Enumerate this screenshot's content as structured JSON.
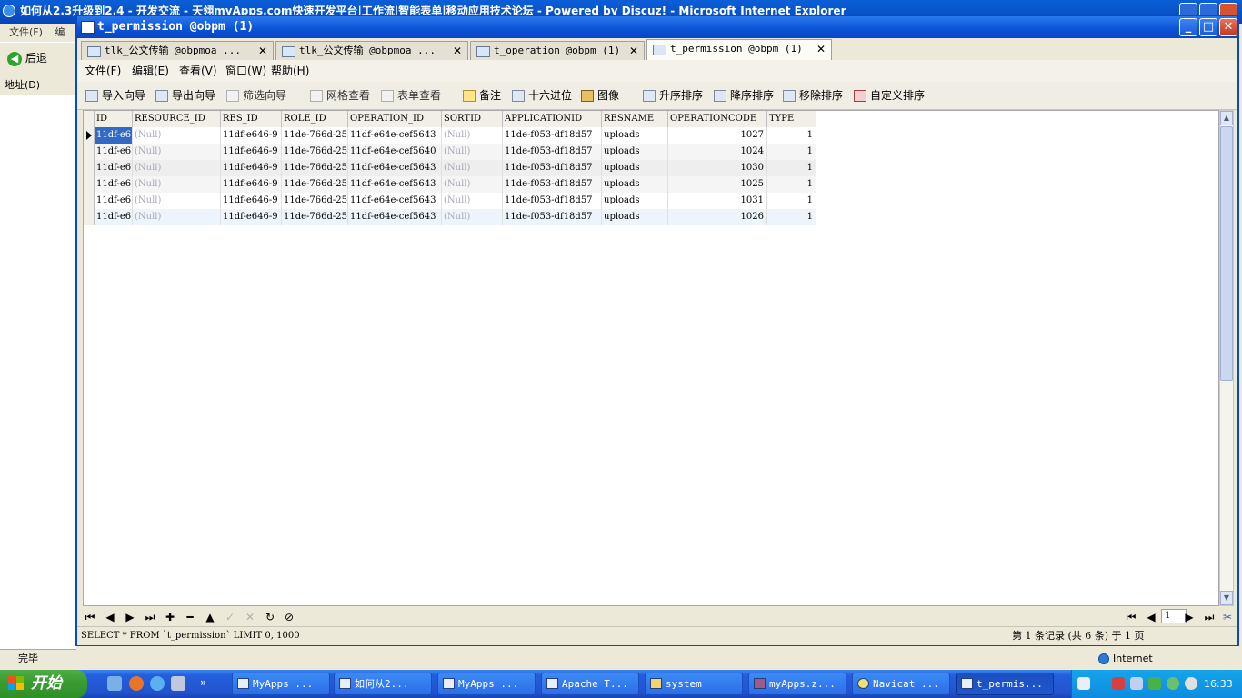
{
  "bg_ie": {
    "title": "如何从2.3升级到2.4 - 开发交流 - 天翎myApps.com快速开发平台|工作流|智能表单|移动应用技术论坛 - Powered by Discuz! - Microsoft Internet Explorer",
    "menu_file": "文件(F)",
    "menu_edit": "编",
    "back_label": "后退",
    "address_label": "地址(D)",
    "status_done": "完毕",
    "zone": "Internet"
  },
  "window": {
    "title": "t_permission @obpm (1)"
  },
  "tabs": [
    {
      "label": "tlk_公文传输 @obpmoa ..."
    },
    {
      "label": "tlk_公文传输 @obpmoa ..."
    },
    {
      "label": "t_operation @obpm (1)"
    },
    {
      "label": "t_permission @obpm (1)"
    }
  ],
  "menu": [
    "文件(F)",
    "编辑(E)",
    "查看(V)",
    "窗口(W)",
    "帮助(H)"
  ],
  "toolbar": {
    "import": "导入向导",
    "export": "导出向导",
    "filter": "筛选向导",
    "grid_view": "网格查看",
    "form_view": "表单查看",
    "memo": "备注",
    "hex": "十六进位",
    "image": "图像",
    "sort_asc": "升序排序",
    "sort_desc": "降序排序",
    "remove_sort": "移除排序",
    "custom_sort": "自定义排序"
  },
  "table": {
    "columns": [
      "ID",
      "RESOURCE_ID",
      "RES_ID",
      "ROLE_ID",
      "OPERATION_ID",
      "SORTID",
      "APPLICATIONID",
      "RESNAME",
      "OPERATIONCODE",
      "TYPE"
    ],
    "rows": [
      [
        "11df-e6",
        "(Null)",
        "11df-e646-9",
        "11de-766d-25",
        "11df-e64e-cef5643",
        "(Null)",
        "11de-f053-df18d57",
        "uploads",
        "1027",
        "1"
      ],
      [
        "11df-e6",
        "(Null)",
        "11df-e646-9",
        "11de-766d-25",
        "11df-e64e-cef5640",
        "(Null)",
        "11de-f053-df18d57",
        "uploads",
        "1024",
        "1"
      ],
      [
        "11df-e6",
        "(Null)",
        "11df-e646-9",
        "11de-766d-25",
        "11df-e64e-cef5643",
        "(Null)",
        "11de-f053-df18d57",
        "uploads",
        "1030",
        "1"
      ],
      [
        "11df-e6",
        "(Null)",
        "11df-e646-9",
        "11de-766d-25",
        "11df-e64e-cef5643",
        "(Null)",
        "11de-f053-df18d57",
        "uploads",
        "1025",
        "1"
      ],
      [
        "11df-e6",
        "(Null)",
        "11df-e646-9",
        "11de-766d-25",
        "11df-e64e-cef5643",
        "(Null)",
        "11de-f053-df18d57",
        "uploads",
        "1031",
        "1"
      ],
      [
        "11df-e6",
        "(Null)",
        "11df-e646-9",
        "11de-766d-25",
        "11df-e64e-cef5643",
        "(Null)",
        "11de-f053-df18d57",
        "uploads",
        "1026",
        "1"
      ]
    ]
  },
  "pager": {
    "page": "1"
  },
  "status": {
    "sql": "SELECT * FROM `t_permission` LIMIT 0, 1000",
    "records": "第 1 条记录 (共 6 条) 于 1 页"
  },
  "taskbar": {
    "start": "开始",
    "tasks": [
      "MyApps ...",
      "如何从2...",
      "MyApps ...",
      "Apache T...",
      "system",
      "myApps.z...",
      "Navicat ...",
      "t_permis..."
    ],
    "clock": "16:33"
  }
}
